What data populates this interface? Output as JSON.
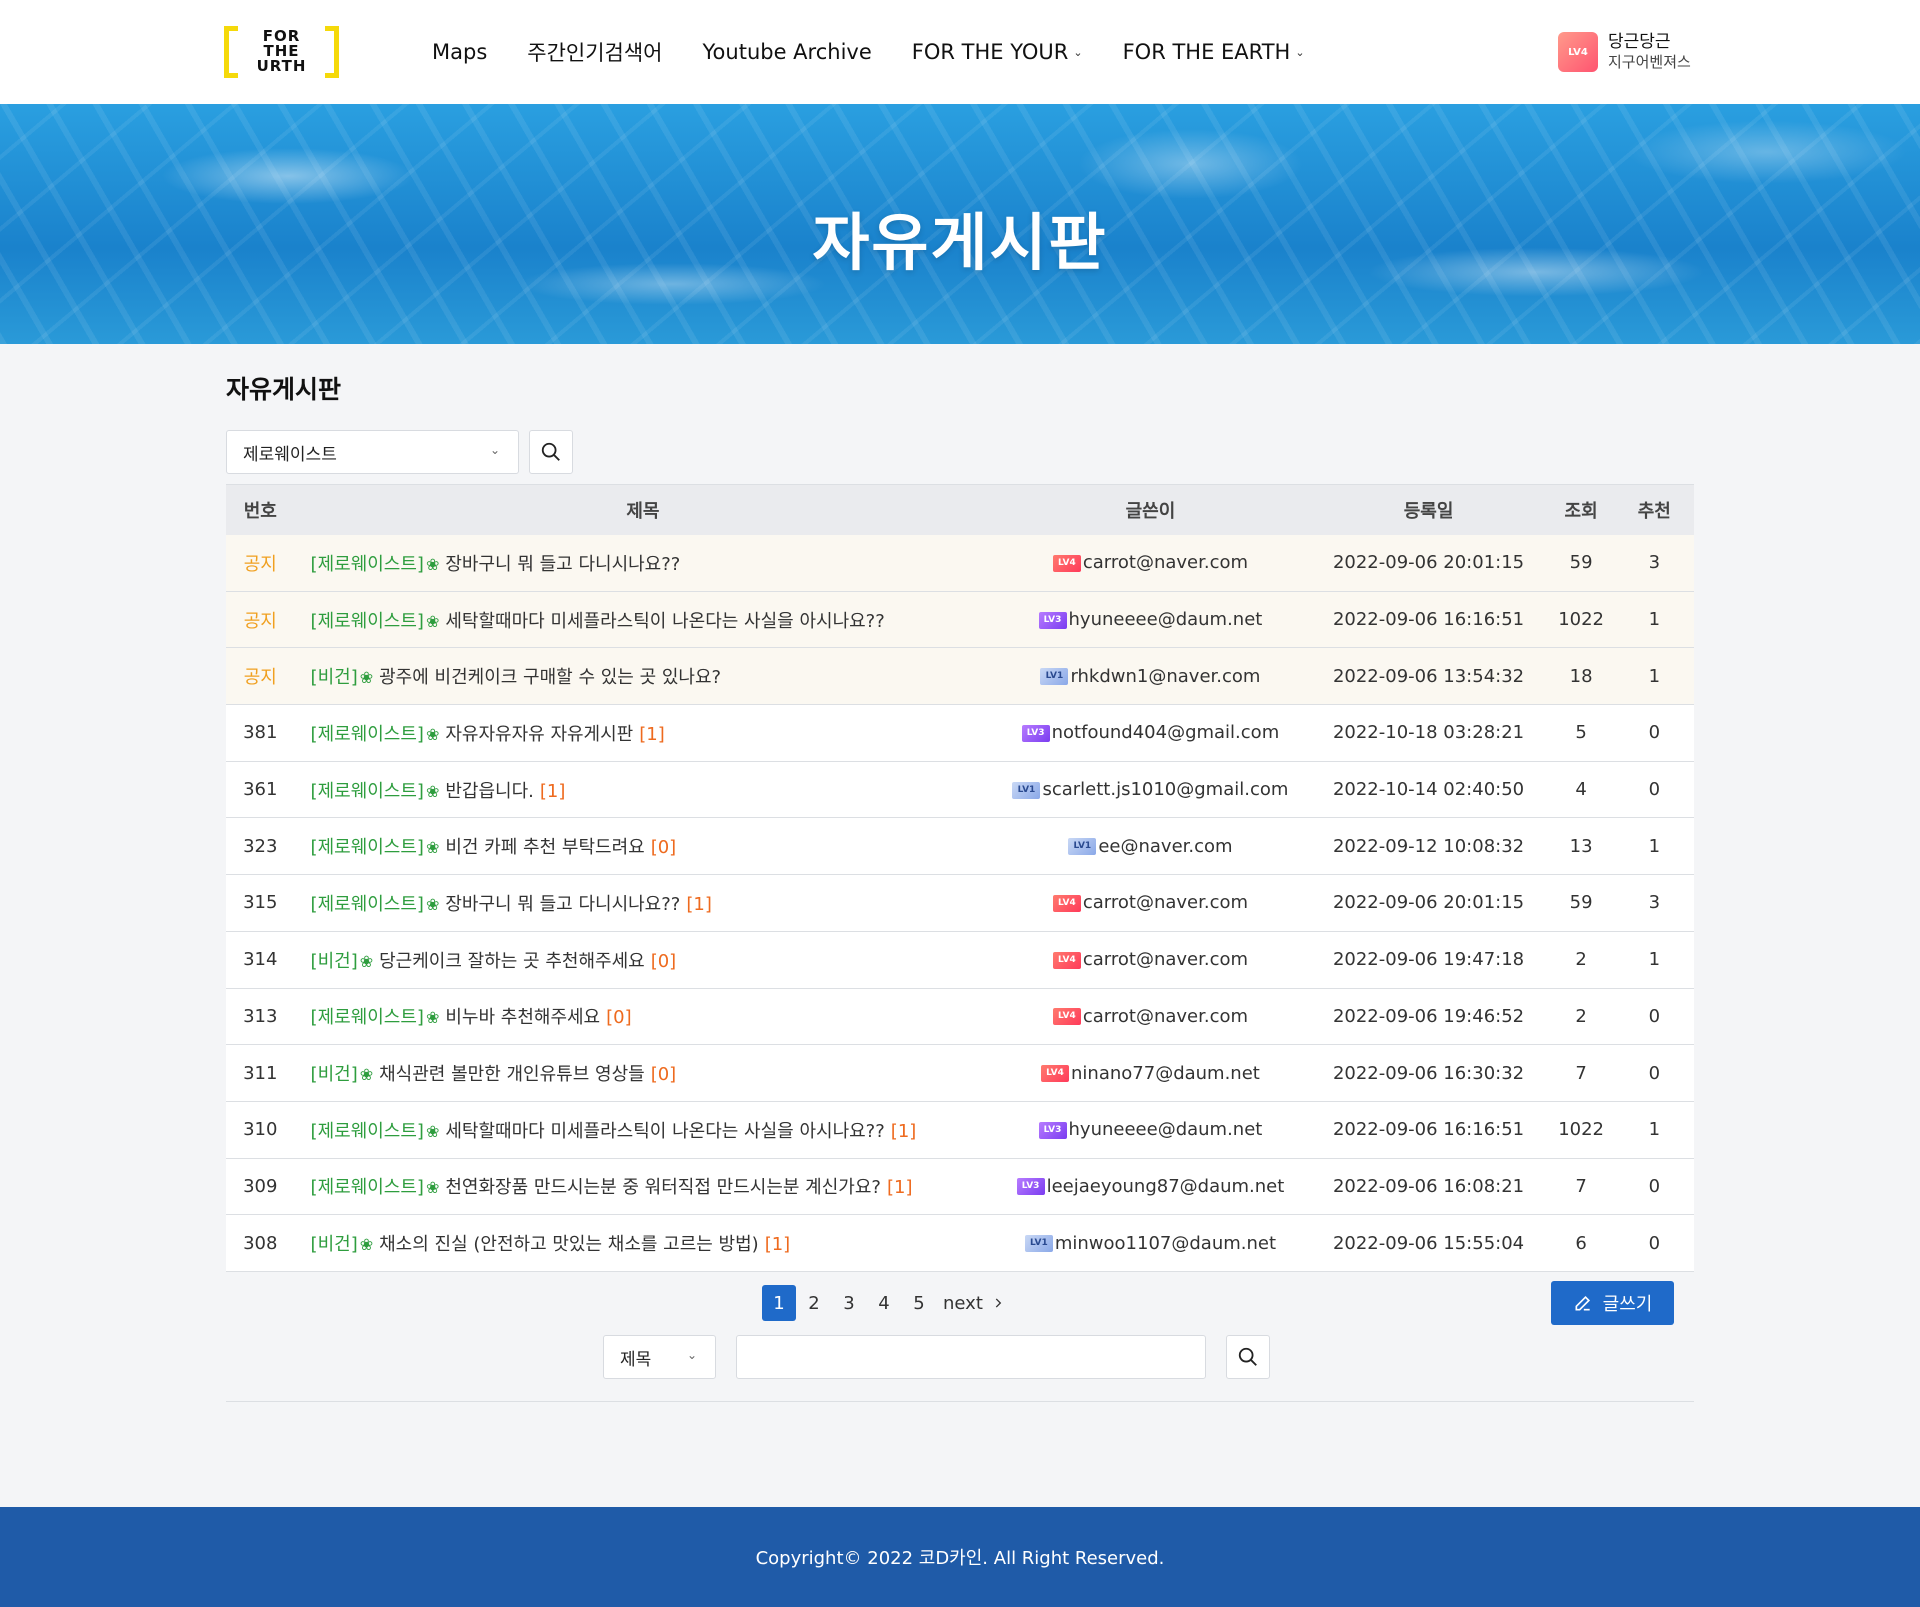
{
  "brand": {
    "logo_text_1": "FOR",
    "logo_text_2": "THE",
    "logo_text_3": "URTH",
    "accent": "#f5d90a"
  },
  "nav": [
    {
      "label": "Maps",
      "dropdown": false
    },
    {
      "label": "주간인기검색어",
      "dropdown": false
    },
    {
      "label": "Youtube Archive",
      "dropdown": false
    },
    {
      "label": "FOR THE YOUR",
      "dropdown": true
    },
    {
      "label": "FOR THE EARTH",
      "dropdown": true
    }
  ],
  "user": {
    "level": "LV4",
    "nickname": "당근당근",
    "team": "지구어벤져스"
  },
  "hero": {
    "title": "자유게시판"
  },
  "board": {
    "title": "자유게시판",
    "category_selected": "제로웨이스트",
    "columns": [
      "번호",
      "제목",
      "글쓴이",
      "등록일",
      "조회",
      "추천"
    ],
    "rows": [
      {
        "num": "공지",
        "notice": true,
        "category": "[제로웨이스트]",
        "title": "장바구니 뭐 들고 다니시나요??",
        "comments": "",
        "level": "LV4",
        "author": "carrot@naver.com",
        "date": "2022-09-06 20:01:15",
        "views": "59",
        "rec": "3"
      },
      {
        "num": "공지",
        "notice": true,
        "category": "[제로웨이스트]",
        "title": "세탁할때마다 미세플라스틱이 나온다는 사실을 아시나요??",
        "comments": "",
        "level": "LV3",
        "author": "hyuneeee@daum.net",
        "date": "2022-09-06 16:16:51",
        "views": "1022",
        "rec": "1"
      },
      {
        "num": "공지",
        "notice": true,
        "category": "[비건]",
        "title": "광주에 비건케이크 구매할 수 있는 곳 있나요?",
        "comments": "",
        "level": "LV1",
        "author": "rhkdwn1@naver.com",
        "date": "2022-09-06 13:54:32",
        "views": "18",
        "rec": "1"
      },
      {
        "num": "381",
        "notice": false,
        "category": "[제로웨이스트]",
        "title": "자유자유자유 자유게시판",
        "comments": "[1]",
        "level": "LV3",
        "author": "notfound404@gmail.com",
        "date": "2022-10-18 03:28:21",
        "views": "5",
        "rec": "0"
      },
      {
        "num": "361",
        "notice": false,
        "category": "[제로웨이스트]",
        "title": "반갑읍니다.",
        "comments": "[1]",
        "level": "LV1",
        "author": "scarlett.js1010@gmail.com",
        "date": "2022-10-14 02:40:50",
        "views": "4",
        "rec": "0"
      },
      {
        "num": "323",
        "notice": false,
        "category": "[제로웨이스트]",
        "title": "비건 카페 추천 부탁드려요",
        "comments": "[0]",
        "level": "LV1",
        "author": "ee@naver.com",
        "date": "2022-09-12 10:08:32",
        "views": "13",
        "rec": "1"
      },
      {
        "num": "315",
        "notice": false,
        "category": "[제로웨이스트]",
        "title": "장바구니 뭐 들고 다니시나요??",
        "comments": "[1]",
        "level": "LV4",
        "author": "carrot@naver.com",
        "date": "2022-09-06 20:01:15",
        "views": "59",
        "rec": "3"
      },
      {
        "num": "314",
        "notice": false,
        "category": "[비건]",
        "title": "당근케이크 잘하는 곳 추천해주세요",
        "comments": "[0]",
        "level": "LV4",
        "author": "carrot@naver.com",
        "date": "2022-09-06 19:47:18",
        "views": "2",
        "rec": "1"
      },
      {
        "num": "313",
        "notice": false,
        "category": "[제로웨이스트]",
        "title": "비누바 추천해주세요",
        "comments": "[0]",
        "level": "LV4",
        "author": "carrot@naver.com",
        "date": "2022-09-06 19:46:52",
        "views": "2",
        "rec": "0"
      },
      {
        "num": "311",
        "notice": false,
        "category": "[비건]",
        "title": "채식관련 볼만한 개인유튜브 영상들",
        "comments": "[0]",
        "level": "LV4",
        "author": "ninano77@daum.net",
        "date": "2022-09-06 16:30:32",
        "views": "7",
        "rec": "0"
      },
      {
        "num": "310",
        "notice": false,
        "category": "[제로웨이스트]",
        "title": "세탁할때마다 미세플라스틱이 나온다는 사실을 아시나요??",
        "comments": "[1]",
        "level": "LV3",
        "author": "hyuneeee@daum.net",
        "date": "2022-09-06 16:16:51",
        "views": "1022",
        "rec": "1"
      },
      {
        "num": "309",
        "notice": false,
        "category": "[제로웨이스트]",
        "title": "천연화장품 만드시는분 중 워터직접 만드시는분 계신가요?",
        "comments": "[1]",
        "level": "LV3",
        "author": "leejaeyoung87@daum.net",
        "date": "2022-09-06 16:08:21",
        "views": "7",
        "rec": "0"
      },
      {
        "num": "308",
        "notice": false,
        "category": "[비건]",
        "title": "채소의 진실 (안전하고 맛있는 채소를 고르는 방법)",
        "comments": "[1]",
        "level": "LV1",
        "author": "minwoo1107@daum.net",
        "date": "2022-09-06 15:55:04",
        "views": "6",
        "rec": "0"
      }
    ]
  },
  "pagination": {
    "pages": [
      "1",
      "2",
      "3",
      "4",
      "5"
    ],
    "active": "1",
    "next_label": "next"
  },
  "write_button": {
    "label": "글쓰기"
  },
  "search": {
    "field_selected": "제목",
    "query": ""
  },
  "footer": {
    "copyright": "Copyright© 2022 코D카인. All Right Reserved."
  },
  "colors": {
    "primary": "#1f6ac9",
    "footer": "#1f5ba8",
    "category": "#2e9d3e",
    "comment": "#ee6a1e",
    "notice": "#f0a020"
  }
}
